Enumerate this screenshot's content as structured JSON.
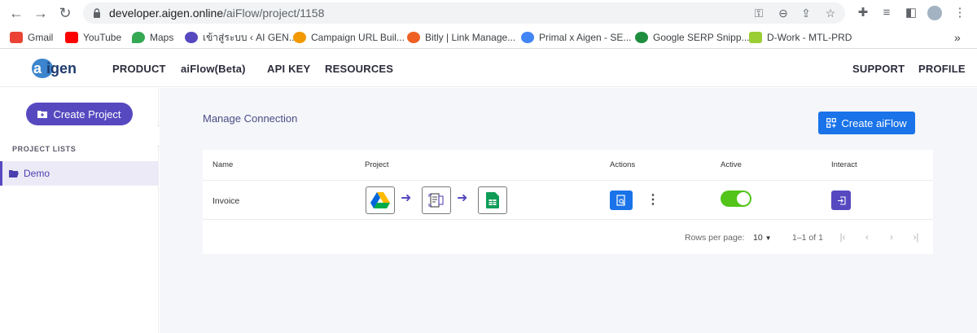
{
  "browser": {
    "url_host": "developer.aigen.online",
    "url_path": "/aiFlow/project/1158",
    "bookmarks": [
      {
        "label": "Gmail",
        "color": "#ea4335"
      },
      {
        "label": "YouTube",
        "color": "#ff0000"
      },
      {
        "label": "Maps",
        "color": "#34a853"
      },
      {
        "label": "เข้าสู่ระบบ ‹ AI GEN...",
        "color": "#5649c0"
      },
      {
        "label": "Campaign URL Buil...",
        "color": "#f29900"
      },
      {
        "label": "Bitly | Link Manage...",
        "color": "#ee6123"
      },
      {
        "label": "Primal x Aigen - SE...",
        "color": "#4285f4"
      },
      {
        "label": "Google SERP Snipp...",
        "color": "#1e8e3e"
      },
      {
        "label": "D-Work - MTL-PRD",
        "color": "#9acd32"
      }
    ],
    "more": "»"
  },
  "header": {
    "logo_text": "aigen",
    "menu": [
      "PRODUCT",
      "aiFlow(Beta)",
      "API KEY",
      "RESOURCES"
    ],
    "right_menu": [
      "SUPPORT",
      "PROFILE"
    ]
  },
  "sidebar": {
    "create_label": "Create Project",
    "section_title": "PROJECT LISTS",
    "items": [
      {
        "label": "Demo"
      }
    ]
  },
  "main": {
    "title": "Manage Connection",
    "create_label": "Create aiFlow",
    "table": {
      "headers": [
        "Name",
        "Project",
        "Actions",
        "Active",
        "Interact"
      ],
      "rows": [
        {
          "name": "Invoice",
          "project_steps": [
            "google-drive-icon",
            "document-scan-icon",
            "google-sheets-icon"
          ],
          "active": true
        }
      ]
    },
    "pagination": {
      "rows_per_page_label": "Rows per page:",
      "rows_per_page_value": "10",
      "range": "1–1 of 1"
    }
  },
  "colors": {
    "primary": "#5649c0",
    "blue": "#1a73e8",
    "active_green": "#52c41a"
  }
}
